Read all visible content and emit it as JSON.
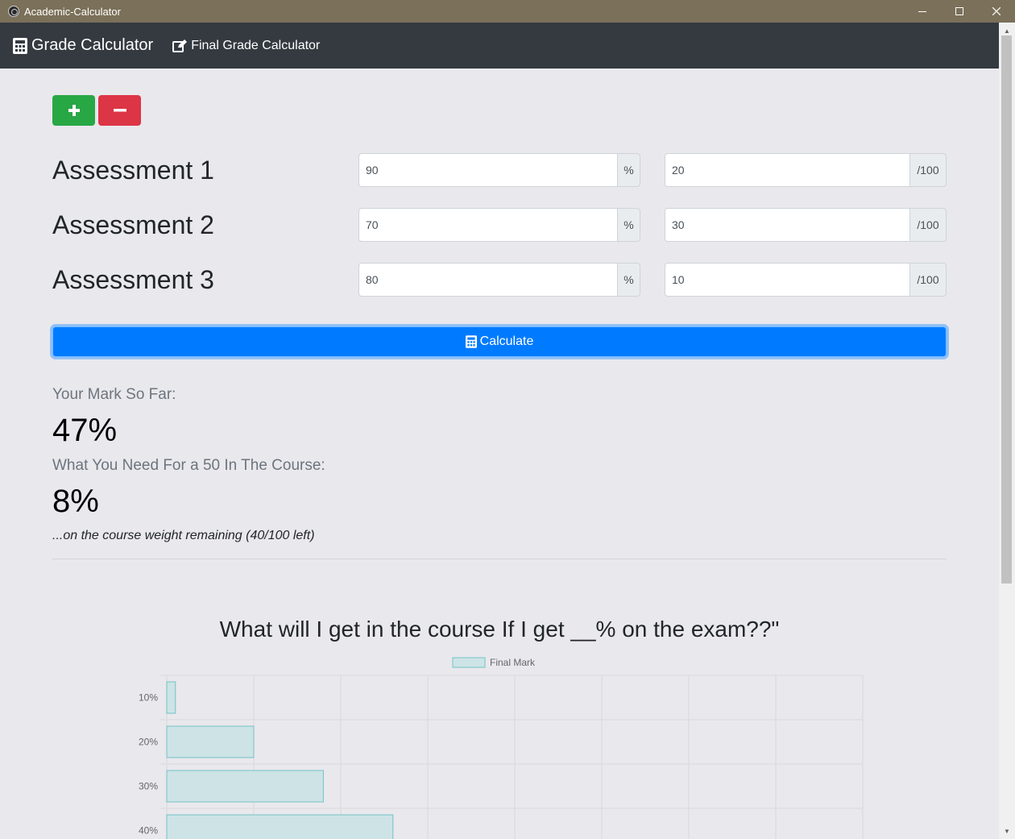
{
  "window": {
    "title": "Academic-Calculator"
  },
  "navbar": {
    "brand": "Grade Calculator",
    "link": "Final Grade Calculator"
  },
  "assessments": [
    {
      "label": "Assessment 1",
      "percent": "90",
      "percent_suffix": "%",
      "weight": "20",
      "weight_suffix": "/100"
    },
    {
      "label": "Assessment 2",
      "percent": "70",
      "percent_suffix": "%",
      "weight": "30",
      "weight_suffix": "/100"
    },
    {
      "label": "Assessment 3",
      "percent": "80",
      "percent_suffix": "%",
      "weight": "10",
      "weight_suffix": "/100"
    }
  ],
  "calculate_label": "Calculate",
  "results": {
    "mark_heading": "Your Mark So Far:",
    "mark_value": "47%",
    "need_heading": "What You Need For a 50 In The Course:",
    "need_value": "8%",
    "note": "...on the course weight remaining (40/100 left)"
  },
  "chart_data": {
    "type": "bar",
    "orientation": "horizontal",
    "title": "What will I get in the course If I get __% on the exam??\"",
    "categories": [
      "10%",
      "20%",
      "30%",
      "40%"
    ],
    "series": [
      {
        "name": "Final Mark",
        "values": [
          1,
          10,
          18,
          26
        ]
      }
    ],
    "xlim": [
      0,
      80
    ],
    "grid": true,
    "legend": "top",
    "colors": {
      "fill": "#cde3e6",
      "stroke": "#72c3c4"
    }
  },
  "colors": {
    "success": "#28a745",
    "danger": "#dc3545",
    "primary": "#007bff",
    "navbar": "#343a40",
    "titlebar": "#7b7059"
  }
}
